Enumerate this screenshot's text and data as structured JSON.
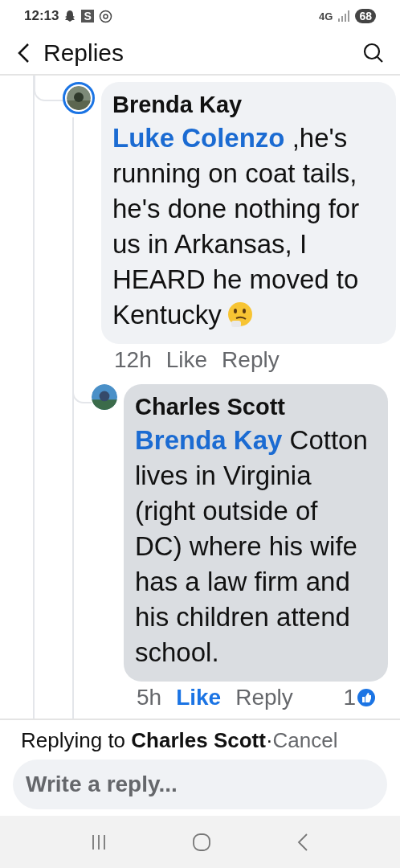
{
  "status_bar": {
    "time": "12:13",
    "app_badge": "S",
    "network": "4G",
    "battery": "68"
  },
  "header": {
    "title": "Replies"
  },
  "comments": [
    {
      "author": "Brenda Kay",
      "mention": "Luke Colenzo",
      "text": " ,he's running on coat tails, he's done nothing for us in Arkansas, I HEARD he moved to Kentucky",
      "emoji": true,
      "highlighted": false,
      "time": "12h",
      "like": "Like",
      "liked": false,
      "reply": "Reply",
      "avatar_ring": true
    },
    {
      "author": "Charles Scott",
      "mention": "Brenda Kay",
      "text": " Cotton lives in Virginia (right outside of DC) where his wife has a law firm and his children attend school.",
      "emoji": false,
      "highlighted": true,
      "time": "5h",
      "like": "Like",
      "liked": true,
      "reply": "Reply",
      "reactions": "1",
      "avatar_ring": false
    }
  ],
  "reply_bar": {
    "prefix": "Replying to ",
    "name": "Charles Scott",
    "separator": "·",
    "cancel": "Cancel",
    "placeholder": "Write a reply..."
  }
}
